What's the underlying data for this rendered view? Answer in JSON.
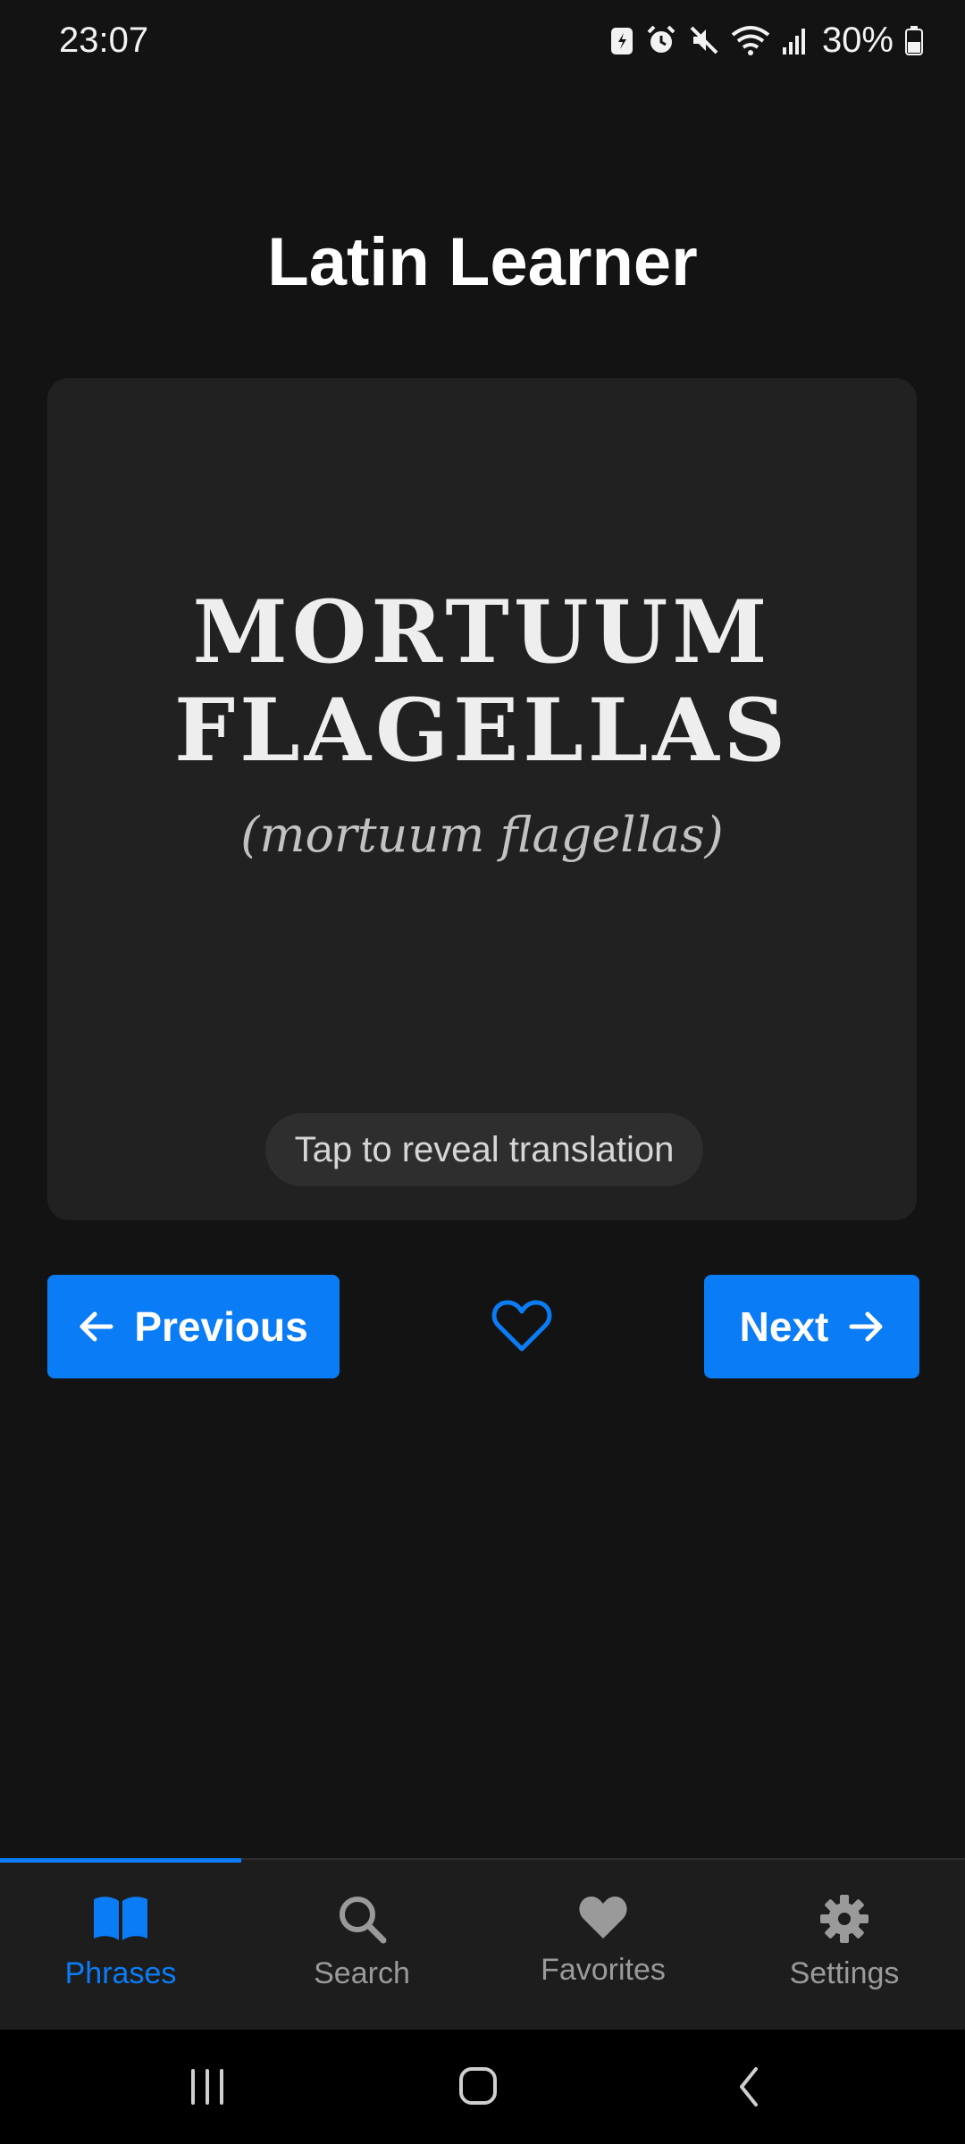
{
  "status_bar": {
    "time": "23:07",
    "battery_percent": "30%",
    "icons": [
      "battery-saver-icon",
      "alarm-icon",
      "mute-icon",
      "wifi-icon",
      "signal-icon",
      "battery-icon"
    ]
  },
  "app": {
    "title": "Latin Learner"
  },
  "card": {
    "phrase_line1": "MORTUUM",
    "phrase_line2": "FLAGELLAS",
    "pronunciation": "(mortuum flagellas)",
    "reveal_hint": "Tap to reveal translation"
  },
  "controls": {
    "previous_label": "Previous",
    "next_label": "Next",
    "favorite_icon": "heart-outline-icon"
  },
  "bottom_nav": {
    "items": [
      {
        "label": "Phrases",
        "icon": "book-open-icon",
        "active": true
      },
      {
        "label": "Search",
        "icon": "search-icon",
        "active": false
      },
      {
        "label": "Favorites",
        "icon": "heart-icon",
        "active": false
      },
      {
        "label": "Settings",
        "icon": "gear-icon",
        "active": false
      }
    ]
  },
  "colors": {
    "accent": "#0a7cf5",
    "background": "#131313",
    "card": "#212121"
  }
}
